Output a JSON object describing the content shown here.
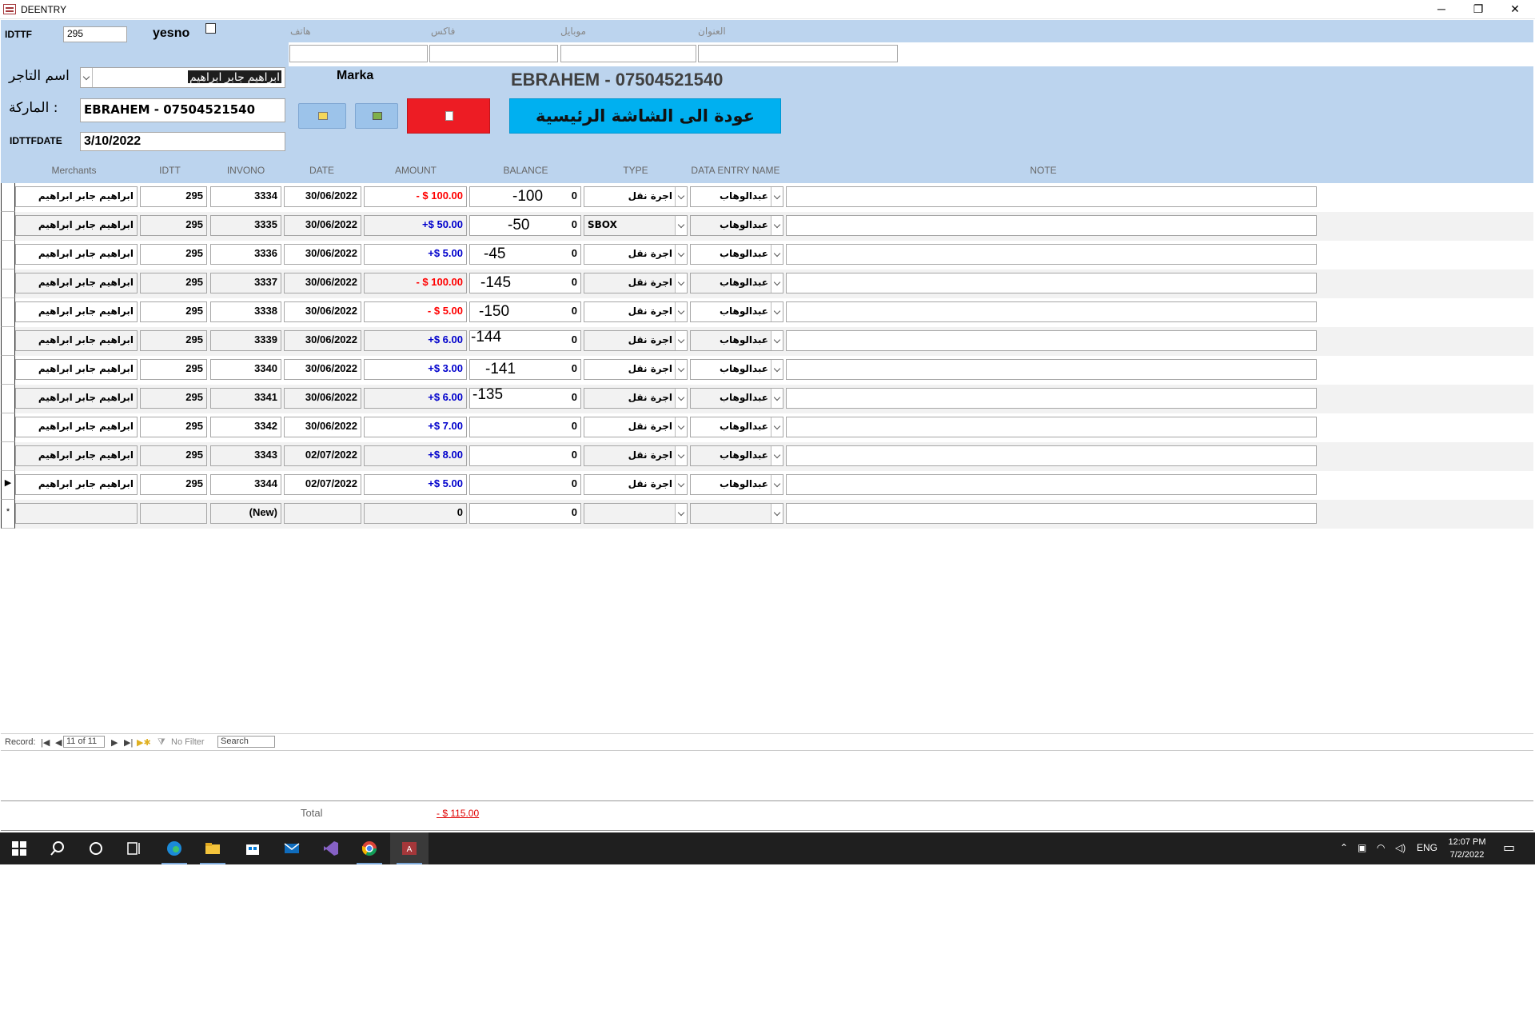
{
  "window": {
    "title": "DEENTRY",
    "minimize": "─",
    "restore": "❐",
    "close": "✕"
  },
  "header": {
    "idttf_label": "IDTTF",
    "idttf_value": "295",
    "yesno_label": "yesno",
    "contact_labels": [
      "هاتف",
      "فاكس",
      "موبايل",
      "العنوان"
    ],
    "merchant_label": "اسم التاجر",
    "merchant_value": "ابراهيم جابر ابراهيم",
    "marka_label": "Marka",
    "marka_display": "EBRAHEM - 07504521540",
    "marka_field_label": "الماركة :",
    "marka_field_value": "EBRAHEM - 07504521540",
    "date_label": "IDTTFDATE",
    "date_value": "3/10/2022",
    "home_button": "عودة الى الشاشة الرئيسية"
  },
  "columns": [
    "Merchants",
    "IDTT",
    "INVONO",
    "DATE",
    "AMOUNT",
    "BALANCE",
    "TYPE",
    "DATA ENTRY NAME",
    "NOTE"
  ],
  "rows": [
    {
      "merchant": "ابراهيم جابر ابراهيم",
      "idtt": "295",
      "invono": "3334",
      "date": "30/06/2022",
      "amount": "- $ 100.00",
      "sign": "neg",
      "balance": "0",
      "overlay": "-100",
      "type": "اجرة نقل",
      "entry": "عبدالوهاب",
      "note": ""
    },
    {
      "merchant": "ابراهيم جابر ابراهيم",
      "idtt": "295",
      "invono": "3335",
      "date": "30/06/2022",
      "amount": "+$ 50.00",
      "sign": "pos",
      "balance": "0",
      "overlay": "-50",
      "type": "SBOX",
      "entry": "عبدالوهاب",
      "note": ""
    },
    {
      "merchant": "ابراهيم جابر ابراهيم",
      "idtt": "295",
      "invono": "3336",
      "date": "30/06/2022",
      "amount": "+$ 5.00",
      "sign": "pos",
      "balance": "0",
      "overlay": "-45",
      "type": "اجرة نقل",
      "entry": "عبدالوهاب",
      "note": ""
    },
    {
      "merchant": "ابراهيم جابر ابراهيم",
      "idtt": "295",
      "invono": "3337",
      "date": "30/06/2022",
      "amount": "- $ 100.00",
      "sign": "neg",
      "balance": "0",
      "overlay": "-145",
      "type": "اجرة نقل",
      "entry": "عبدالوهاب",
      "note": ""
    },
    {
      "merchant": "ابراهيم جابر ابراهيم",
      "idtt": "295",
      "invono": "3338",
      "date": "30/06/2022",
      "amount": "- $ 5.00",
      "sign": "neg",
      "balance": "0",
      "overlay": "-150",
      "type": "اجرة نقل",
      "entry": "عبدالوهاب",
      "note": ""
    },
    {
      "merchant": "ابراهيم جابر ابراهيم",
      "idtt": "295",
      "invono": "3339",
      "date": "30/06/2022",
      "amount": "+$ 6.00",
      "sign": "pos",
      "balance": "0",
      "overlay": "-144",
      "type": "اجرة نقل",
      "entry": "عبدالوهاب",
      "note": ""
    },
    {
      "merchant": "ابراهيم جابر ابراهيم",
      "idtt": "295",
      "invono": "3340",
      "date": "30/06/2022",
      "amount": "+$ 3.00",
      "sign": "pos",
      "balance": "0",
      "overlay": "-141",
      "type": "اجرة نقل",
      "entry": "عبدالوهاب",
      "note": ""
    },
    {
      "merchant": "ابراهيم جابر ابراهيم",
      "idtt": "295",
      "invono": "3341",
      "date": "30/06/2022",
      "amount": "+$ 6.00",
      "sign": "pos",
      "balance": "0",
      "overlay": "-135",
      "type": "اجرة نقل",
      "entry": "عبدالوهاب",
      "note": ""
    },
    {
      "merchant": "ابراهيم جابر ابراهيم",
      "idtt": "295",
      "invono": "3342",
      "date": "30/06/2022",
      "amount": "+$ 7.00",
      "sign": "pos",
      "balance": "0",
      "overlay": "",
      "type": "اجرة نقل",
      "entry": "عبدالوهاب",
      "note": ""
    },
    {
      "merchant": "ابراهيم جابر ابراهيم",
      "idtt": "295",
      "invono": "3343",
      "date": "02/07/2022",
      "amount": "+$ 8.00",
      "sign": "pos",
      "balance": "0",
      "overlay": "",
      "type": "اجرة نقل",
      "entry": "عبدالوهاب",
      "note": ""
    },
    {
      "merchant": "ابراهيم جابر ابراهيم",
      "idtt": "295",
      "invono": "3344",
      "date": "02/07/2022",
      "amount": "+$ 5.00",
      "sign": "pos",
      "balance": "0",
      "overlay": "",
      "type": "اجرة نقل",
      "entry": "عبدالوهاب",
      "note": ""
    }
  ],
  "new_row": {
    "invono": "(New)",
    "amount": "0",
    "balance": "0",
    "marker": "*"
  },
  "current_marker": "▶",
  "navbar": {
    "record_label": "Record:",
    "record_value": "11 of 11",
    "filter_label": "No Filter",
    "search_label": "Search"
  },
  "footer": {
    "total_label": "Total",
    "total_value": "- $ 115.00"
  },
  "taskbar": {
    "language": "ENG",
    "time": "12:07 PM",
    "date": "7/2/2022"
  },
  "colors": {
    "header_bg": "#bcd4ee",
    "negative": "#ff0000",
    "positive": "#0000cc",
    "home_button": "#00b0f0",
    "delete_button": "#ed1c24"
  }
}
